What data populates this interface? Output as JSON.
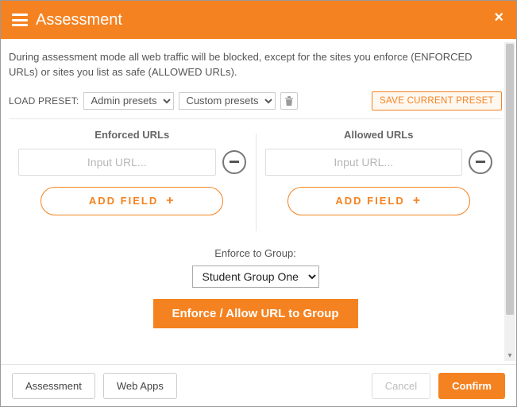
{
  "header": {
    "title": "Assessment"
  },
  "description": "During assessment mode all web traffic will be blocked, except for the sites you enforce (ENFORCED URLs) or sites you list as safe (ALLOWED URLs).",
  "presets": {
    "label": "LOAD PRESET:",
    "admin_selected": "Admin presets",
    "custom_selected": "Custom presets",
    "save_label": "SAVE CURRENT PRESET"
  },
  "columns": {
    "enforced": {
      "heading": "Enforced URLs",
      "placeholder": "Input URL...",
      "add_label": "ADD FIELD"
    },
    "allowed": {
      "heading": "Allowed URLs",
      "placeholder": "Input URL...",
      "add_label": "ADD FIELD"
    }
  },
  "group": {
    "label": "Enforce to Group:",
    "selected": "Student Group One",
    "button": "Enforce / Allow URL to Group"
  },
  "footer": {
    "tab_assessment": "Assessment",
    "tab_webapps": "Web Apps",
    "cancel": "Cancel",
    "confirm": "Confirm"
  },
  "colors": {
    "accent": "#f58220"
  }
}
